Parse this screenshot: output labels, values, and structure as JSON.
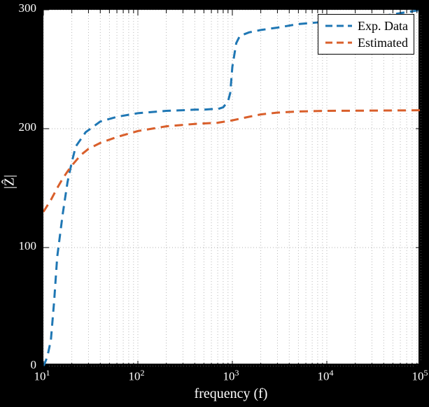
{
  "chart_data": {
    "type": "line",
    "title": "",
    "xlabel": "frequency (f)",
    "ylabel": "|Zhat|",
    "xscale": "log",
    "xlim": [
      10,
      100000
    ],
    "ylim": [
      0,
      300
    ],
    "xticks": [
      {
        "v": 10,
        "label": "10^1"
      },
      {
        "v": 100,
        "label": "10^2"
      },
      {
        "v": 1000,
        "label": "10^3"
      },
      {
        "v": 10000,
        "label": "10^4"
      },
      {
        "v": 100000,
        "label": "10^5"
      }
    ],
    "yticks": [
      0,
      100,
      200,
      300
    ],
    "legend_position": "upper right",
    "series": [
      {
        "name": "Exp. Data",
        "color": "#1f77b4",
        "dash": "12,8",
        "x": [
          10,
          11,
          12,
          13,
          14,
          16,
          18,
          20,
          22,
          28,
          40,
          60,
          100,
          200,
          300,
          400,
          500,
          600,
          700,
          800,
          900,
          950,
          1000,
          1100,
          1200,
          1500,
          2000,
          3000,
          5000,
          10000,
          20000,
          40000,
          70000,
          100000
        ],
        "y": [
          0,
          8,
          22,
          55,
          92,
          128,
          155,
          172,
          185,
          197,
          206,
          210,
          213,
          215,
          215.5,
          216,
          216,
          216.5,
          216.5,
          218,
          223,
          230,
          252,
          272,
          278,
          281,
          283,
          285,
          288,
          290,
          292.5,
          295,
          298,
          300
        ]
      },
      {
        "name": "Estimated",
        "color": "#d95f2b",
        "dash": "12,8",
        "x": [
          10,
          12,
          14,
          16,
          18,
          20,
          25,
          30,
          40,
          60,
          100,
          200,
          400,
          700,
          1000,
          1500,
          2000,
          3000,
          5000,
          10000,
          50000,
          100000
        ],
        "y": [
          130,
          140,
          150,
          158,
          164,
          169,
          178,
          183,
          188,
          193,
          198,
          202,
          204,
          205,
          207,
          210,
          212,
          213.5,
          214.5,
          215,
          215.3,
          215.5
        ]
      }
    ]
  },
  "legend": {
    "items": [
      {
        "label": "Exp. Data",
        "color": "#1f77b4"
      },
      {
        "label": "Estimated",
        "color": "#d95f2b"
      }
    ]
  },
  "axis_labels": {
    "x": "frequency (f)",
    "y": "|Ẑ|"
  }
}
